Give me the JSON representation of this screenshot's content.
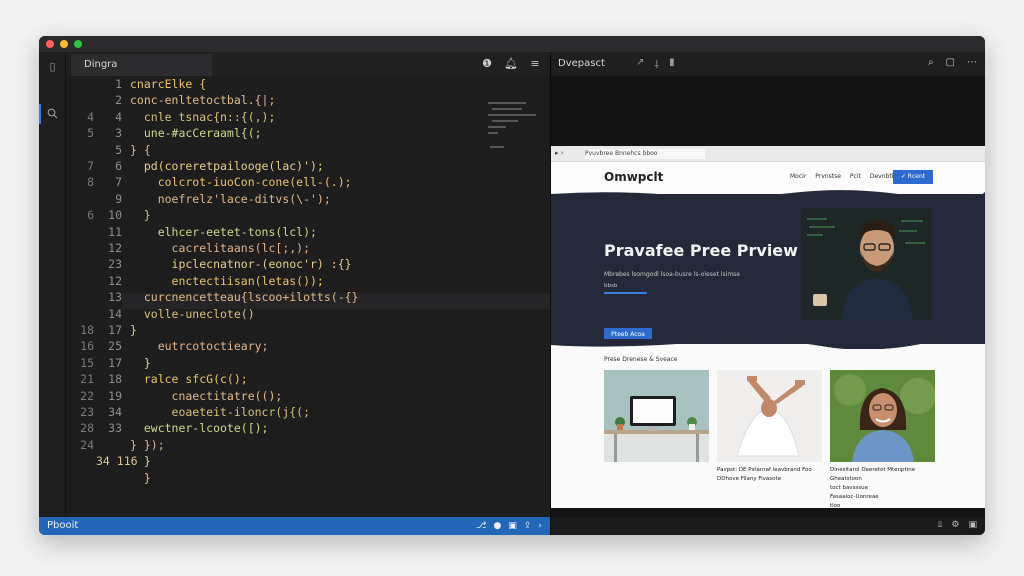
{
  "editor": {
    "tab_label": "Dingra",
    "status_label": "Pbooit",
    "gutter_a": [
      "",
      "",
      "4",
      "5",
      "",
      "7",
      "8",
      "",
      "6",
      "",
      "",
      "",
      "",
      "",
      "",
      "18",
      "16",
      "15",
      "21",
      "22",
      "23",
      "28",
      "24"
    ],
    "gutter_b": [
      "1",
      "2",
      "4",
      "3",
      "5",
      "6",
      "7",
      "9",
      "10",
      "11",
      "12",
      "23",
      "12",
      "13",
      "14",
      "17",
      "25",
      "17",
      "18",
      "19",
      "34",
      "33",
      "",
      "34 116"
    ],
    "code_lines": [
      "cnarcElke {",
      "conc-enltetoctbal.{|;",
      "  cnle tsnac{n::{(,);",
      "  une-#acCeraaml{(;",
      "} {",
      "  pd(coreretpailooge(lac)');",
      "    colcrot-iuoCon-cone(ell-(.);",
      "    noefrelz'lace-ditvs(\\-');",
      "  }",
      "    elhcer-eetet-tons(lcl);",
      "      cacrelitaans(lc[;,);",
      "      ipclecnatnor-(eonoc'r) :{}",
      "      enctectiisan(letas());",
      "  curcnencetteau{lscoo+ilotts(-{}",
      "  volle-uneclote()",
      "}",
      "    eutrcotoctieary;",
      "  }",
      "  ralce sfcG(c();",
      "      cnaectitatre(();",
      "      eoaeteit-iloncr(j{(;",
      "  ewctner-lcoote([);",
      "} });",
      "  }",
      "  }"
    ]
  },
  "preview": {
    "pane_title": "Dvepasct",
    "url": "Pvuvbree Bnnehcs bboo",
    "logo": "Omwpclt",
    "nav_links": [
      "Mocir",
      "Prvnstse",
      "Pcit",
      "Devnbtk"
    ],
    "nav_button": "✓ Rcent",
    "hero_title": "Pravafee Pree Prview",
    "hero_sub": "Mbrebes lsomgodl lsoa-busre ls-oleset lsimse",
    "hero_small": "bbsb",
    "hero_button": "Pteeb Acoa",
    "section_label": "Prese Drenese & Sveace",
    "card1_caption": "Pavpst: DE Pstanraf leavbrand Foo DDhove Filany Fivasote",
    "card3_caption": "Dinesitarol Deeretot Mtenptine Gheatstoon\ntoct bavsssue\nFasaaloc-Uonreae\ntloo"
  },
  "colors": {
    "accent": "#2f6bcf",
    "status_bar": "#2366b8",
    "hero_bg": "#242939"
  }
}
